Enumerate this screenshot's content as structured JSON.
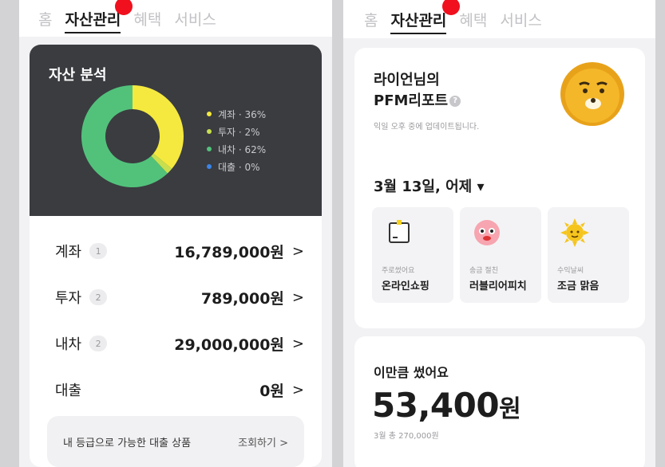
{
  "left": {
    "nav": {
      "tabs": [
        "홈",
        "자산관리",
        "혜택",
        "서비스"
      ],
      "active_index": 1
    },
    "analysis": {
      "title": "자산 분석",
      "legend": [
        {
          "label": "계좌 · 36%",
          "color": "#f5e93f"
        },
        {
          "label": "투자 · 2%",
          "color": "#c7df4e"
        },
        {
          "label": "내차 · 62%",
          "color": "#52c27b"
        },
        {
          "label": "대출 · 0%",
          "color": "#3b85e8"
        }
      ]
    },
    "rows": [
      {
        "label": "계좌",
        "badge": "1",
        "amount": "16,789,000원",
        "chevron": ">"
      },
      {
        "label": "투자",
        "badge": "2",
        "amount": "789,000원",
        "chevron": ">"
      },
      {
        "label": "내차",
        "badge": "2",
        "amount": "29,000,000원",
        "chevron": ">"
      },
      {
        "label": "대출",
        "badge": "",
        "amount": "0원",
        "chevron": ">"
      }
    ],
    "loan_box": {
      "text": "내 등급으로 가능한 대출 상품",
      "link": "조회하기 >"
    }
  },
  "chart_data": {
    "type": "pie",
    "categories": [
      "계좌",
      "투자",
      "내차",
      "대출"
    ],
    "values": [
      36,
      2,
      62,
      0
    ],
    "colors": [
      "#f5e93f",
      "#c7df4e",
      "#52c27b",
      "#3b85e8"
    ],
    "title": "자산 분석"
  },
  "right": {
    "nav": {
      "tabs": [
        "홈",
        "자산관리",
        "혜택",
        "서비스"
      ],
      "active_index": 1
    },
    "report": {
      "title_line1": "라이언님의",
      "title_line2": "PFM리포트",
      "help_icon": "?",
      "subtitle": "익일 오후 중에 업데이트됩니다.",
      "date": "3월 13일, 어제 ▾"
    },
    "tiles": [
      {
        "caption": "주로썼어요",
        "value": "온라인쇼핑",
        "icon": "shopping-box-icon"
      },
      {
        "caption": "송금 절친",
        "value": "러블리어피치",
        "icon": "apeach-character-icon"
      },
      {
        "caption": "수익날씨",
        "value": "조금 맑음",
        "icon": "sun-icon"
      }
    ],
    "spend": {
      "label": "이만큼 썼어요",
      "amount": "53,400",
      "unit": "원",
      "sub": "3월 총 270,000원"
    }
  }
}
